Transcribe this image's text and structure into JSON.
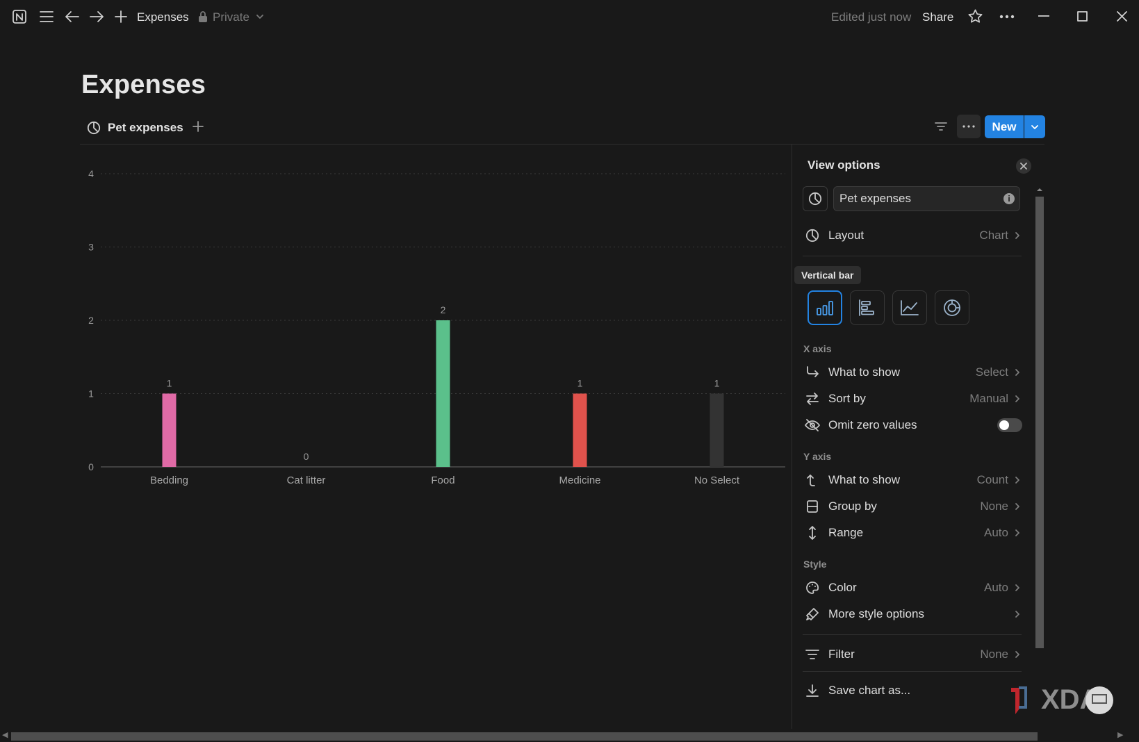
{
  "topbar": {
    "page_name": "Expenses",
    "privacy": "Private",
    "edited_status": "Edited just now",
    "share_label": "Share"
  },
  "page": {
    "title": "Expenses",
    "view_tab_label": "Pet expenses",
    "new_button_label": "New"
  },
  "chart_data": {
    "type": "bar",
    "categories": [
      "Bedding",
      "Cat litter",
      "Food",
      "Medicine",
      "No Select"
    ],
    "values": [
      1,
      0,
      2,
      1,
      1
    ],
    "data_labels": [
      "1",
      "0",
      "2",
      "1",
      "1"
    ],
    "colors": [
      "#e06aa6",
      "#3a3a3a",
      "#5bc08b",
      "#e0524c",
      "#333333"
    ],
    "yticks": [
      0,
      1,
      2,
      3,
      4
    ],
    "ylim": [
      0,
      4
    ],
    "grid": true,
    "gridline_style": "dotted",
    "title": "",
    "xlabel": "",
    "ylabel": ""
  },
  "panel": {
    "title": "View options",
    "view_name": "Pet expenses",
    "tooltip": "Vertical bar",
    "layout": {
      "label": "Layout",
      "value": "Chart"
    },
    "chart_types": [
      "vertical-bar",
      "horizontal-bar",
      "line",
      "donut"
    ],
    "x_axis": {
      "title": "X axis",
      "what_to_show": {
        "label": "What to show",
        "value": "Select"
      },
      "sort_by": {
        "label": "Sort by",
        "value": "Manual"
      },
      "omit_zero": {
        "label": "Omit zero values",
        "enabled": false
      }
    },
    "y_axis": {
      "title": "Y axis",
      "what_to_show": {
        "label": "What to show",
        "value": "Count"
      },
      "group_by": {
        "label": "Group by",
        "value": "None"
      },
      "range": {
        "label": "Range",
        "value": "Auto"
      }
    },
    "style": {
      "title": "Style",
      "color": {
        "label": "Color",
        "value": "Auto"
      },
      "more": {
        "label": "More style options"
      }
    },
    "filter": {
      "label": "Filter",
      "value": "None"
    },
    "save_chart": {
      "label": "Save chart as..."
    }
  },
  "watermark": {
    "text": "XDA"
  },
  "accent_color": "#2383e2"
}
